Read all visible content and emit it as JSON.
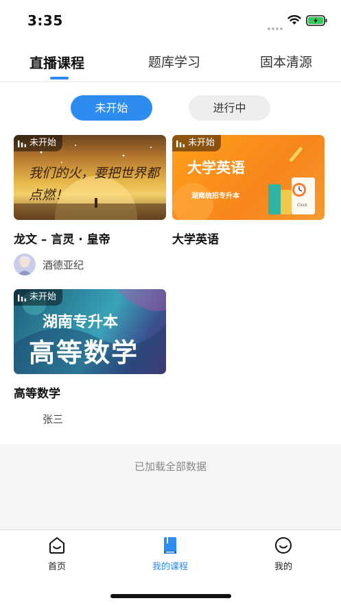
{
  "status_bar": {
    "time": "3:35"
  },
  "tabs": [
    {
      "label": "直播课程",
      "active": true
    },
    {
      "label": "题库学习",
      "active": false
    },
    {
      "label": "固本清源",
      "active": false
    }
  ],
  "filters": {
    "not_started": "未开始",
    "in_progress": "进行中"
  },
  "courses": [
    {
      "title": "龙文 – 言灵 · 皇帝",
      "status": "未开始",
      "teacher": "酒德亚纪",
      "thumb_text": "我们的火，要把世界都点燃！"
    },
    {
      "title": "大学英语",
      "status": "未开始",
      "teacher": "",
      "thumb_text": "大学英语",
      "thumb_sub": "湖南统招专升本"
    },
    {
      "title": "高等数学",
      "status": "未开始",
      "teacher": "张三",
      "thumb_text": "高等数学",
      "thumb_sub": "湖南专升本"
    }
  ],
  "list_footer": "已加载全部数据",
  "bottom_nav": [
    {
      "label": "首页",
      "icon": "home-smile-icon",
      "active": false
    },
    {
      "label": "我的课程",
      "icon": "book-icon",
      "active": true
    },
    {
      "label": "我的",
      "icon": "smile-face-icon",
      "active": false
    }
  ],
  "colors": {
    "accent": "#2d8cf0",
    "pill_inactive": "#eeeeee",
    "footer_bg": "#f4f5f7"
  }
}
